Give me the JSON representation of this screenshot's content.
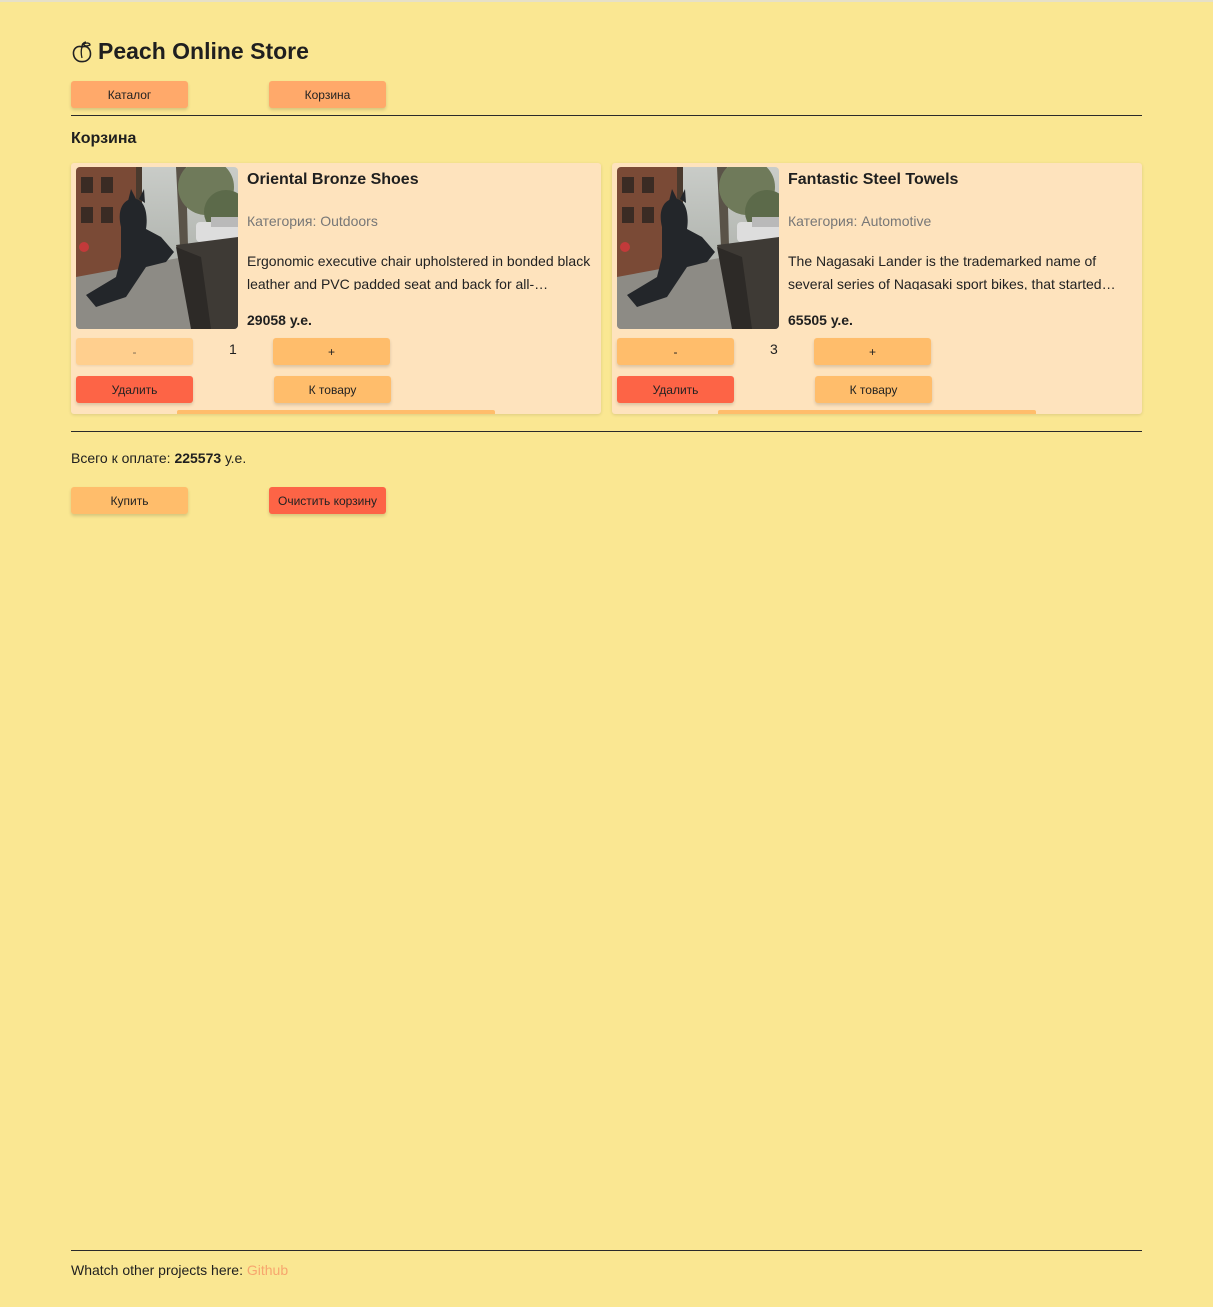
{
  "header": {
    "title": "Peach Online Store",
    "icon": "peach-icon"
  },
  "nav": {
    "catalog_label": "Каталог",
    "cart_label": "Корзина"
  },
  "cart": {
    "heading": "Корзина",
    "items": [
      {
        "name": "Oriental Bronze Shoes",
        "category": "Категория: Outdoors",
        "description": "Ergonomic executive chair upholstered in bonded black leather and PVC padded seat and back for all-…",
        "price": "29058 у.е.",
        "quantity": "1",
        "minus_label": "-",
        "plus_label": "+",
        "delete_label": "Удалить",
        "to_product_label": "К товару"
      },
      {
        "name": "Fantastic Steel Towels",
        "category": "Категория: Automotive",
        "description": "The Nagasaki Lander is the trademarked name of several series of Nagasaki sport bikes, that started…",
        "price": "65505 у.е.",
        "quantity": "3",
        "minus_label": "-",
        "plus_label": "+",
        "delete_label": "Удалить",
        "to_product_label": "К товару"
      }
    ],
    "total_prefix": "Всего к оплате: ",
    "total_value": "225573",
    "total_suffix": " у.е.",
    "buy_label": "Купить",
    "clear_label": "Очистить корзину"
  },
  "footer": {
    "text": "Whatch other projects here: ",
    "link_label": "Github"
  },
  "colors": {
    "background": "#fae792",
    "card": "#fee3bd",
    "accent_orange": "#ffbd6b",
    "accent_salmon": "#ffa96a",
    "danger_red": "#fd6446",
    "link": "#f7a66e"
  }
}
